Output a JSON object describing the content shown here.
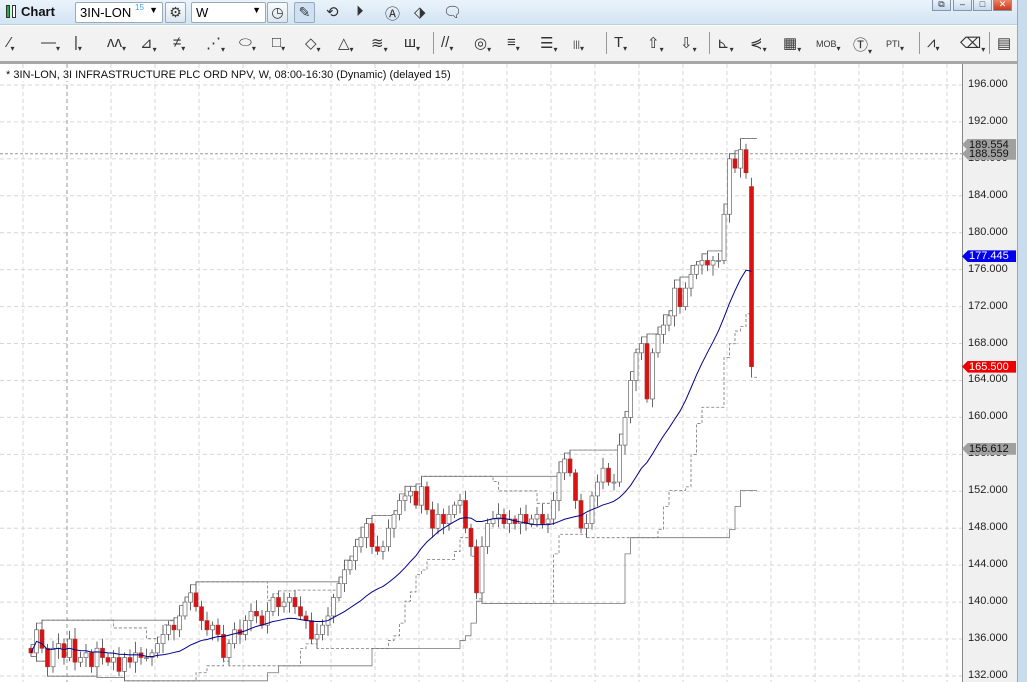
{
  "titlebar": {
    "title": "Chart",
    "symbol": "3IN-LON",
    "symbol_badge": "15",
    "interval": "W",
    "icons": [
      "settings-gear-icon",
      "clock-icon",
      "pencil-icon",
      "indicator-icon",
      "play-icon",
      "alert-icon",
      "link-icon",
      "comment-icon"
    ],
    "window_buttons": [
      "restore",
      "minimize",
      "maximize",
      "close"
    ]
  },
  "toolbar": {
    "tools": [
      {
        "name": "trend-line",
        "glyph": "⁄"
      },
      {
        "name": "horizontal-line",
        "glyph": "—"
      },
      {
        "name": "vertical-line",
        "glyph": "|"
      },
      {
        "name": "polyline",
        "glyph": "ᴧᴧ"
      },
      {
        "name": "fan",
        "glyph": "⊿"
      },
      {
        "name": "parallel",
        "glyph": "≠"
      },
      {
        "name": "speed-lines",
        "glyph": "⋰"
      },
      {
        "name": "ellipse",
        "glyph": "⬭"
      },
      {
        "name": "rectangle",
        "glyph": "□"
      },
      {
        "name": "rotated-rectangle",
        "glyph": "◇"
      },
      {
        "name": "triangle",
        "glyph": "△"
      },
      {
        "name": "channel",
        "glyph": "≋"
      },
      {
        "name": "cycles",
        "glyph": "ш"
      },
      {
        "name": "fib-lines",
        "glyph": "//"
      },
      {
        "name": "circles",
        "glyph": "◎"
      },
      {
        "name": "fib-retracement",
        "glyph": "≡"
      },
      {
        "name": "fib-extension",
        "glyph": "☰"
      },
      {
        "name": "time-zones",
        "glyph": "|||"
      },
      {
        "name": "text",
        "glyph": "T"
      },
      {
        "name": "arrow-up",
        "glyph": "⇧"
      },
      {
        "name": "arrow-down",
        "glyph": "⇩"
      },
      {
        "name": "gann-fan",
        "glyph": "⊾"
      },
      {
        "name": "andrews",
        "glyph": "⋞"
      },
      {
        "name": "grid",
        "glyph": "▦"
      },
      {
        "name": "mob",
        "glyph": "MOB"
      },
      {
        "name": "tj",
        "glyph": "Ⓣ"
      },
      {
        "name": "pti",
        "glyph": "PTI"
      },
      {
        "name": "zigzag",
        "glyph": "⩘"
      },
      {
        "name": "eraser",
        "glyph": "⌫"
      },
      {
        "name": "notes",
        "glyph": "▤"
      }
    ]
  },
  "chart_data": {
    "type": "candlestick",
    "title": "* 3IN-LON, 3I INFRASTRUCTURE PLC ORD NPV, W, 08:00-16:30 (Dynamic) (delayed 15)",
    "ylim": [
      132,
      198
    ],
    "yticks": [
      "196.000",
      "192.000",
      "188.000",
      "184.000",
      "180.000",
      "176.000",
      "172.000",
      "168.000",
      "164.000",
      "160.000",
      "156.000",
      "152.000",
      "148.000",
      "144.000",
      "140.000",
      "136.000",
      "132.000"
    ],
    "closes": [
      134.5,
      137,
      135,
      133,
      135,
      135.5,
      134,
      136,
      133.5,
      134,
      134.5,
      133,
      135,
      134,
      133.5,
      134,
      132.5,
      134,
      133.5,
      134.5,
      134,
      134,
      134.5,
      135.5,
      136.5,
      137.5,
      137,
      138.5,
      140,
      141,
      139.5,
      138,
      137,
      137.5,
      136.5,
      134,
      135.5,
      137,
      136.5,
      138,
      139,
      138.5,
      137.5,
      139,
      140.5,
      139.5,
      140,
      140.5,
      139.5,
      138.5,
      138,
      136,
      136.5,
      137.5,
      138.5,
      140.5,
      142,
      143.5,
      144.5,
      146,
      147,
      148.5,
      146,
      145.5,
      146,
      148,
      149.5,
      151,
      151.5,
      152,
      150.5,
      152.5,
      150,
      148,
      149.5,
      148.5,
      149.5,
      150.5,
      151,
      148,
      146,
      141,
      146,
      148.5,
      149,
      149.5,
      148.5,
      149,
      148.5,
      149.5,
      148.5,
      149,
      149.5,
      148.5,
      149,
      151,
      154,
      155.5,
      154,
      151,
      148,
      148.5,
      151.5,
      153,
      154.5,
      153,
      153,
      157,
      160,
      164,
      167,
      168,
      162,
      167,
      169,
      170,
      171,
      174,
      172,
      174,
      175.5,
      176.5,
      177,
      176.5,
      177,
      177,
      182,
      188,
      187,
      189,
      186.5,
      165.5
    ],
    "last_open": 185,
    "ma_period": 20,
    "price_labels": [
      {
        "value": "189.554",
        "price": 189.554,
        "color": "#a0a0a0",
        "text_color": "#111"
      },
      {
        "value": "188.559",
        "price": 188.559,
        "color": "#a0a0a0",
        "text_color": "#111"
      },
      {
        "value": "177.445",
        "price": 177.445,
        "color": "#0000ee",
        "text_color": "#fff"
      },
      {
        "value": "165.500",
        "price": 165.5,
        "color": "#ee0000",
        "text_color": "#fff"
      },
      {
        "value": "156.612",
        "price": 156.612,
        "color": "#a0a0a0",
        "text_color": "#111"
      }
    ],
    "ref_line": 188.559,
    "colors": {
      "down": "#dd1111",
      "up": "#ffffff",
      "ma": "#00008b",
      "band": "#777777"
    }
  }
}
